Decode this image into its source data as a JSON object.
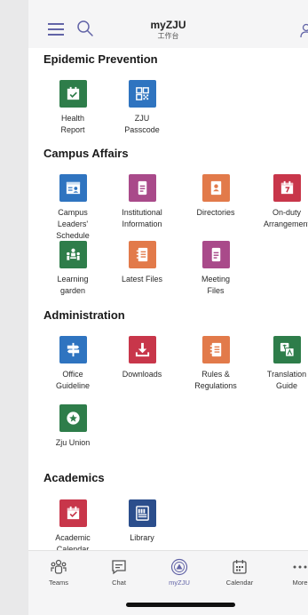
{
  "header": {
    "title": "myZJU",
    "subtitle": "工作台"
  },
  "sections": {
    "epidemic": {
      "title": "Epidemic Prevention",
      "apps": [
        {
          "label": "Health\nReport",
          "color": "#2e7d4a",
          "icon": "calendar-check-icon"
        },
        {
          "label": "ZJU\nPasscode",
          "color": "#2f74c0",
          "icon": "qr-code-icon"
        }
      ]
    },
    "campus": {
      "title": "Campus Affairs",
      "apps": [
        {
          "label": "Campus\nLeaders'\nSchedule",
          "color": "#2f74c0",
          "icon": "schedule-person-icon"
        },
        {
          "label": "Institutional\nInformation",
          "color": "#a94a8a",
          "icon": "document-icon"
        },
        {
          "label": "Directories",
          "color": "#e27a4a",
          "icon": "contact-card-icon"
        },
        {
          "label": "On-duty\nArrangement",
          "color": "#c8364a",
          "icon": "calendar-seven-icon"
        },
        {
          "label": "Learning\ngarden",
          "color": "#2e7d4a",
          "icon": "classroom-icon"
        },
        {
          "label": "Latest Files",
          "color": "#e27a4a",
          "icon": "notebook-icon"
        },
        {
          "label": "Meeting\nFiles",
          "color": "#a94a8a",
          "icon": "document-icon"
        }
      ]
    },
    "administration": {
      "title": "Administration",
      "apps": [
        {
          "label": "Office\nGuideline",
          "color": "#2f74c0",
          "icon": "signpost-icon"
        },
        {
          "label": "Downloads",
          "color": "#c8364a",
          "icon": "download-icon"
        },
        {
          "label": "Rules &\nRegulations",
          "color": "#e27a4a",
          "icon": "notebook-icon"
        },
        {
          "label": "Translation\nGuide",
          "color": "#2e7d4a",
          "icon": "translate-icon"
        },
        {
          "label": "Zju Union",
          "color": "#2e7d4a",
          "icon": "union-badge-icon"
        }
      ]
    },
    "academics": {
      "title": "Academics",
      "apps": [
        {
          "label": "Academic\nCalendar",
          "color": "#c8364a",
          "icon": "calendar-check-icon"
        },
        {
          "label": "Library",
          "color": "#2b4e8c",
          "icon": "library-icon"
        }
      ]
    }
  },
  "nav": {
    "teams": "Teams",
    "chat": "Chat",
    "myzju": "myZJU",
    "calendar": "Calendar",
    "more": "More"
  },
  "colors": {
    "accent": "#6264a7"
  }
}
